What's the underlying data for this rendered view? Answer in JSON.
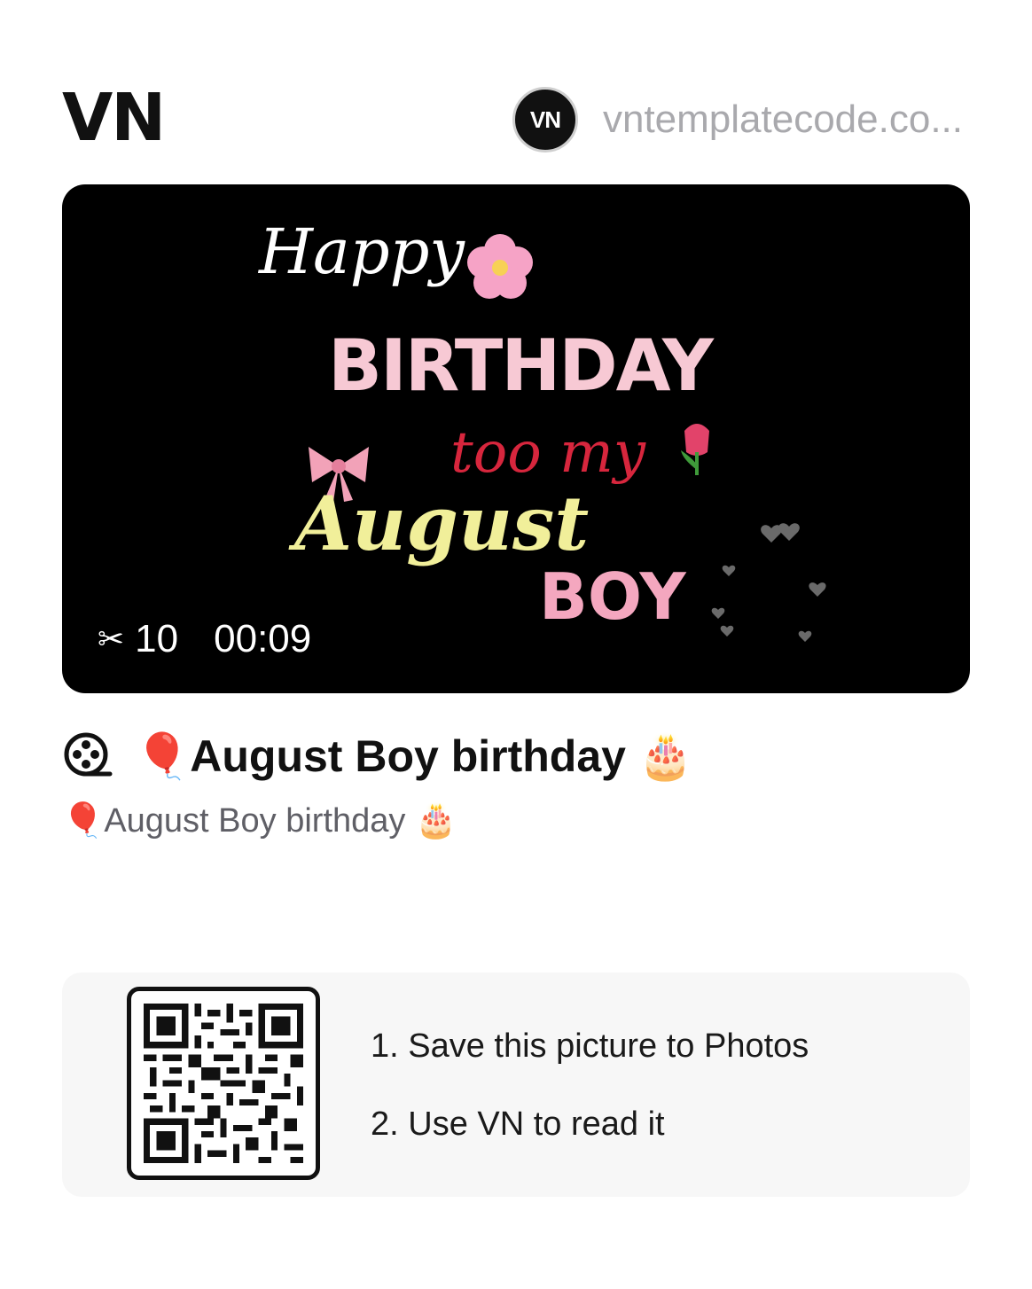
{
  "header": {
    "logo": "VN",
    "avatar_text": "VN",
    "author_name": "vntemplatecode.co..."
  },
  "video": {
    "overlay": {
      "happy": "Happy",
      "birthday": "BIRTHDAY",
      "too_my": "too my",
      "august": "August",
      "boy": "BOY"
    },
    "clips_count": "10",
    "duration": "00:09",
    "icon": "scissors-icon"
  },
  "template": {
    "title": "🎈August Boy birthday 🎂",
    "description": "🎈August Boy birthday 🎂",
    "title_icon": "film-reel-icon"
  },
  "qr_section": {
    "step1": "1. Save this picture to Photos",
    "step2": "2. Use VN to read it"
  },
  "colors": {
    "video_bg": "#000000",
    "card_bg": "#f7f7f7",
    "birthday_pink": "#f7c9d4",
    "too_my_red": "#d7263d",
    "august_yellow": "#f1ef9a",
    "boy_pink": "#f4a7bf"
  }
}
